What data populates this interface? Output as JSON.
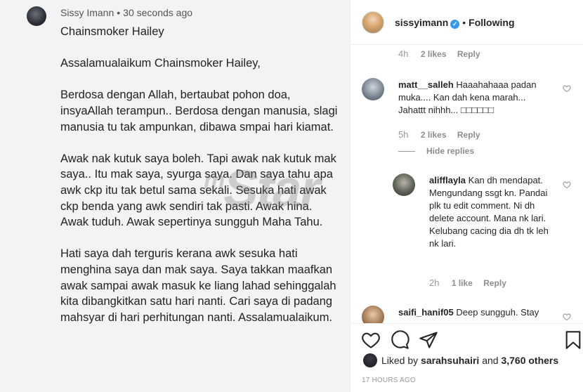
{
  "screenshot_comment": {
    "author": "Sissy Imann",
    "time": "30 seconds ago",
    "paragraphs": [
      "Chainsmoker Hailey",
      "Assalamualaikum Chainsmoker Hailey,",
      "Berdosa dengan Allah, bertaubat pohon doa, insyaAllah terampun.. Berdosa dengan manusia, slagi manusia tu tak ampunkan, dibawa smpai hari kiamat.",
      "Awak nak kutuk saya boleh. Tapi awak nak kutuk mak saya.. Itu mak saya, syurga saya. Dan saya tahu apa awk ckp itu tak betul sama sekali. Sesuka hati awak ckp benda yang awk sendiri tak pasti. Awak hina. Awak tuduh. Awak sepertinya sungguh Maha Tahu.",
      "Hati saya dah terguris kerana awk sesuka hati menghina saya dan mak saya. Saya takkan maafkan awak sampai awak masuk ke liang lahad sehinggalah kita dibangkitkan satu hari nanti. Cari saya di padang mahsyar di hari perhitungan nanti. Assalamualaikum."
    ],
    "watermark_prefix": "m",
    "watermark": "Star"
  },
  "post": {
    "username": "sissyimann",
    "follow_status": "Following",
    "verified_symbol": "✓",
    "dot": "•"
  },
  "comments": {
    "first_meta": {
      "time": "4h",
      "likes": "2 likes",
      "reply": "Reply"
    },
    "items": [
      {
        "username": "matt__salleh",
        "text": "Haaahahaaa padan muka.... Kan dah kena marah... Jahattt nihhh... □□□□□□",
        "time": "5h",
        "likes": "2 likes",
        "reply": "Reply",
        "hide_replies": "Hide replies"
      },
      {
        "username": "alifflayla",
        "text": "Kan dh mendapat. Mengundang ssgt kn. Pandai plk tu edit comment. Ni dh delete account. Mana nk lari. Kelubang cacing dia dh tk leh nk lari.",
        "time": "2h",
        "likes": "1 like",
        "reply": "Reply"
      },
      {
        "username": "saifi_hanif05",
        "text": "Deep sungguh. Stay"
      }
    ]
  },
  "footer": {
    "liked_prefix": "Liked by",
    "liked_user": "sarahsuhairi",
    "liked_and": "and",
    "liked_count": "3,760 others",
    "posted_ago": "17 HOURS AGO"
  },
  "icons": {
    "heart": "heart-icon",
    "comment": "comment-icon",
    "share": "share-icon",
    "bookmark": "bookmark-icon"
  }
}
